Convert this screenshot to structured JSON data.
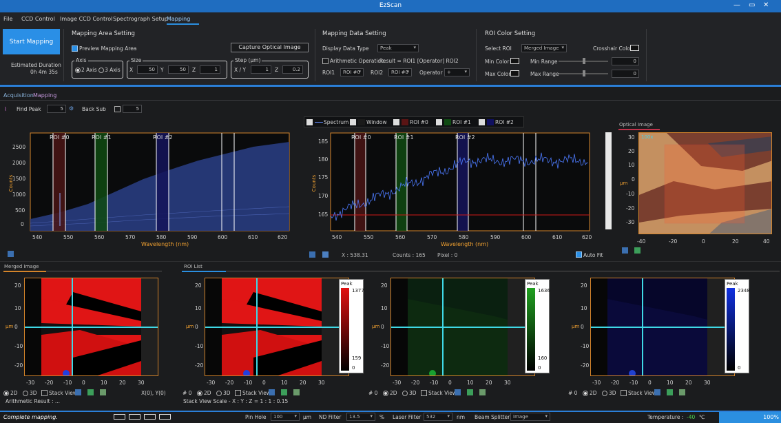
{
  "window": {
    "title": "EzScan",
    "minimize": "—",
    "maximize": "▭",
    "close": "✕"
  },
  "menu": {
    "file": "File",
    "tabs": [
      "CCD Control",
      "Image CCD Control",
      "Spectrograph Setup",
      "Mapping"
    ]
  },
  "ribbon": {
    "start_mapping": "Start Mapping",
    "estimated_label": "Estimated Duration",
    "estimated_value": "0h 4m 35s",
    "area": {
      "title": "Mapping Area Setting",
      "preview": "Preview Mapping Area",
      "capture": "Capture Optical Image",
      "axis_title": "Axis",
      "axis2": "2 Axis",
      "axis3": "3 Axis",
      "size_title": "Size",
      "x": "X",
      "x_val": "50",
      "y": "Y",
      "y_val": "50",
      "z": "Z",
      "z_val": "1",
      "step_title": "Step (μm)",
      "xy": "X / Y",
      "xy_val": "1",
      "sz": "Z",
      "sz_val": "0.2"
    },
    "data": {
      "title": "Mapping Data Setting",
      "display_type": "Display Data Type",
      "display_val": "Peak",
      "arith": "Arithmetic Operation",
      "result": "Result = ROI1 [Operator] ROI2",
      "roi1": "ROI1",
      "roi1_val": "ROI #0",
      "roi2": "ROI2",
      "roi2_val": "ROI #0",
      "operator": "Operator",
      "operator_val": "+"
    },
    "roi": {
      "title": "ROI Color Setting",
      "select": "Select ROI",
      "select_val": "Merged Image",
      "crosshair": "Crosshair Color",
      "min_color": "Min Color",
      "max_color": "Max Color",
      "min_range": "Min Range",
      "max_range": "Max Range",
      "min_val": "0",
      "max_val": "0"
    }
  },
  "subtabs": {
    "acquisition": "Acquisition",
    "mapping": "Mapping"
  },
  "peak": {
    "find": "Find Peak",
    "find_val": "5",
    "back": "Back Sub",
    "back_val": "5"
  },
  "legend": [
    "Spectrum",
    "Window",
    "ROI #0",
    "ROI #1",
    "ROI #2"
  ],
  "roi_labels": [
    "ROI #0",
    "ROI #1",
    "ROI #2"
  ],
  "spec1": {
    "yticks": [
      "2500",
      "2000",
      "1500",
      "1000",
      "500",
      "0"
    ],
    "ylabel": "Counts",
    "xticks": [
      "550",
      "560",
      "570",
      "580",
      "590",
      "600",
      "610",
      "620"
    ],
    "xfirst": "540",
    "xlabel": "Wavelength (nm)"
  },
  "spec2": {
    "yticks": [
      "185",
      "180",
      "175",
      "170",
      "165"
    ],
    "ylabel": "Counts",
    "xticks": [
      "540",
      "550",
      "560",
      "570",
      "580",
      "590",
      "600",
      "610",
      "620"
    ],
    "xlabel": "Wavelength (nm)",
    "x_readout": "X : 538.31",
    "counts": "Counts : 165",
    "pixel": "Pixel : 0",
    "autofit": "Auto Fit"
  },
  "optical": {
    "title": "Optical Image",
    "mag": "100x",
    "yticks": [
      "30",
      "20",
      "10",
      "0",
      "-10",
      "-20",
      "-30"
    ],
    "xticks": [
      "-40",
      "-20",
      "0",
      "20",
      "40"
    ],
    "ylabel": "μm"
  },
  "merged": {
    "title": "Merged Image",
    "yticks": [
      "20",
      "10",
      "0",
      "-10",
      "-20"
    ],
    "xticks": [
      "-30",
      "-20",
      "-10",
      "0",
      "10",
      "20",
      "30"
    ],
    "ylabel": "μm",
    "opt2d": "2D",
    "opt3d": "3D",
    "stack": "Stack View",
    "coord": "X(0), Y(0)",
    "arith": "Arithmetic Result :  ..."
  },
  "roi_list": {
    "title": "ROI List",
    "index": "# 0",
    "scale": "Stack View Scale - X : Y : Z = 1 : 1 : 0.15",
    "bars": [
      {
        "label": "Peak",
        "max": "1377",
        "min": "159",
        "zero": "0",
        "color": "#e01010"
      },
      {
        "label": "Peak",
        "max": "1636",
        "min": "160",
        "zero": "0",
        "color": "#20a020"
      },
      {
        "label": "Peak",
        "max": "2348",
        "min": "",
        "zero": "0",
        "color": "#1030e0"
      }
    ]
  },
  "status": {
    "message": "Complete mapping.",
    "pinhole": "Pin Hole",
    "pinhole_val": "100",
    "pinhole_unit": "μm",
    "nd": "ND Filter",
    "nd_val": "13.5",
    "nd_unit": "%",
    "laser": "Laser Filter",
    "laser_val": "532",
    "laser_unit": "nm",
    "beam": "Beam Splitter",
    "beam_val": "Image",
    "temp": "Temperature :",
    "temp_val": "-40",
    "temp_unit": "℃",
    "progress": "100%"
  }
}
